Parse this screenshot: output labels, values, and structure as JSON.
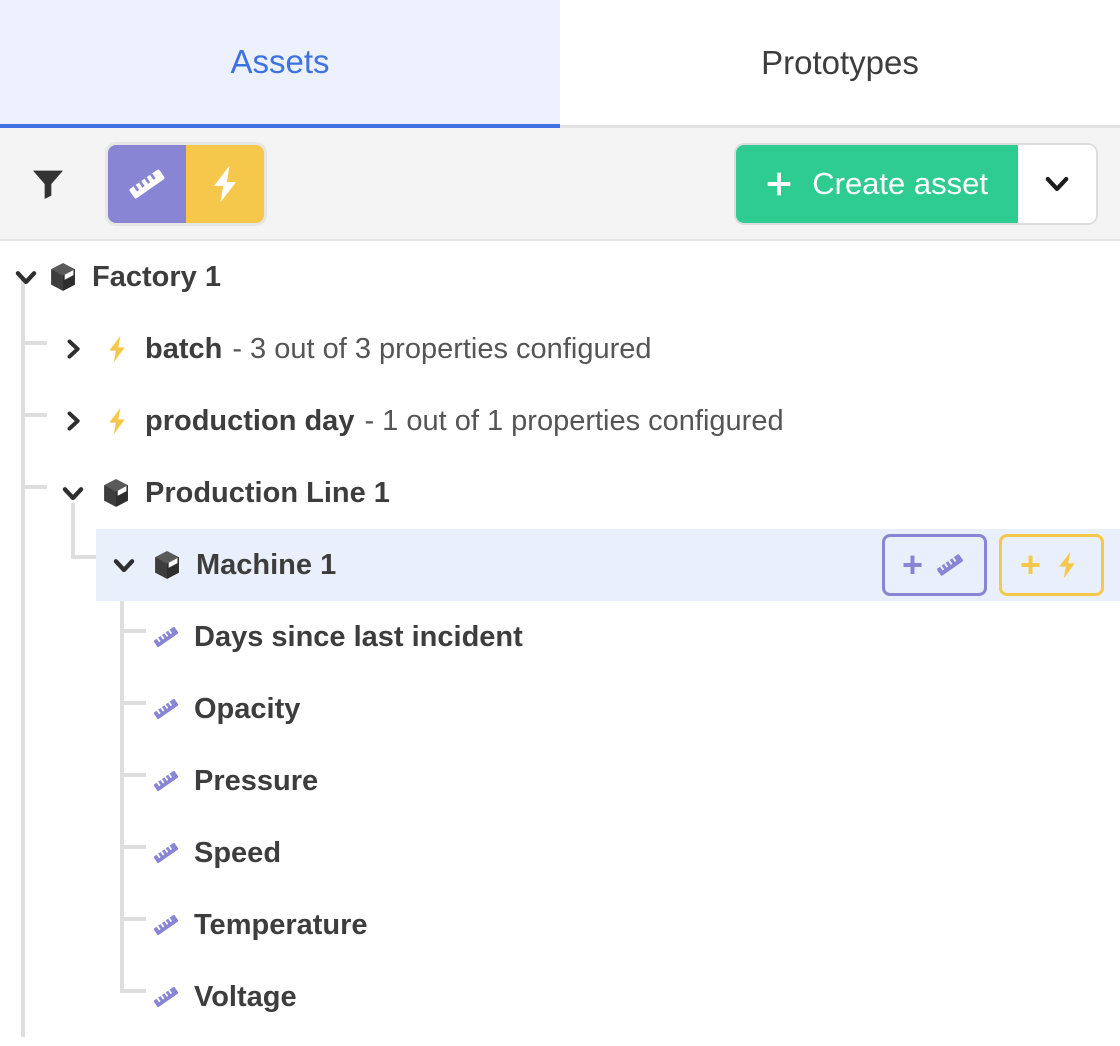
{
  "tabs": [
    {
      "label": "Assets",
      "active": true
    },
    {
      "label": "Prototypes",
      "active": false
    }
  ],
  "toolbar": {
    "filter_icon": "filter-funnel-icon",
    "toggles": [
      {
        "name": "measurement-toggle",
        "icon": "ruler-icon",
        "color": "#8885d5",
        "active": true
      },
      {
        "name": "event-toggle",
        "icon": "lightning-icon",
        "color": "#f5c84b",
        "active": true
      }
    ],
    "create_label": "Create asset",
    "create_plus": "+",
    "create_color": "#2fcc92",
    "create_caret_icon": "chevron-down-icon"
  },
  "tree": {
    "nodes": [
      {
        "label": "Factory 1",
        "suffix": "",
        "icon": "package-box-icon",
        "expanded": true,
        "depth": 0,
        "selected": false
      },
      {
        "label": "batch",
        "suffix": " - 3 out of 3 properties configured",
        "icon": "lightning-icon",
        "expanded": false,
        "depth": 1,
        "selected": false
      },
      {
        "label": "production day",
        "suffix": " - 1 out of 1 properties configured",
        "icon": "lightning-icon",
        "expanded": false,
        "depth": 1,
        "selected": false
      },
      {
        "label": "Production Line 1",
        "suffix": "",
        "icon": "package-box-icon",
        "expanded": true,
        "depth": 1,
        "selected": false
      },
      {
        "label": "Machine 1",
        "suffix": "",
        "icon": "package-box-icon",
        "expanded": true,
        "depth": 2,
        "selected": true
      },
      {
        "label": "Days since last incident",
        "suffix": "",
        "icon": "ruler-icon",
        "depth": 3,
        "selected": false
      },
      {
        "label": "Opacity",
        "suffix": "",
        "icon": "ruler-icon",
        "depth": 3,
        "selected": false
      },
      {
        "label": "Pressure",
        "suffix": "",
        "icon": "ruler-icon",
        "depth": 3,
        "selected": false
      },
      {
        "label": "Speed",
        "suffix": "",
        "icon": "ruler-icon",
        "depth": 3,
        "selected": false
      },
      {
        "label": "Temperature",
        "suffix": "",
        "icon": "ruler-icon",
        "depth": 3,
        "selected": false
      },
      {
        "label": "Voltage",
        "suffix": "",
        "icon": "ruler-icon",
        "depth": 3,
        "selected": false
      }
    ],
    "row_actions": {
      "add_measurement_plus": "+",
      "add_measurement_icon": "ruler-icon",
      "add_event_plus": "+",
      "add_event_icon": "lightning-icon"
    }
  },
  "colors": {
    "accent_blue": "#3d72e0",
    "tab_active_bg": "#ecf1fd",
    "row_selected_bg": "#e9effb",
    "measurement_purple": "#8885d5",
    "event_yellow": "#f5c84b",
    "create_green": "#2fcc92",
    "text_dark": "#3d3d3d"
  }
}
